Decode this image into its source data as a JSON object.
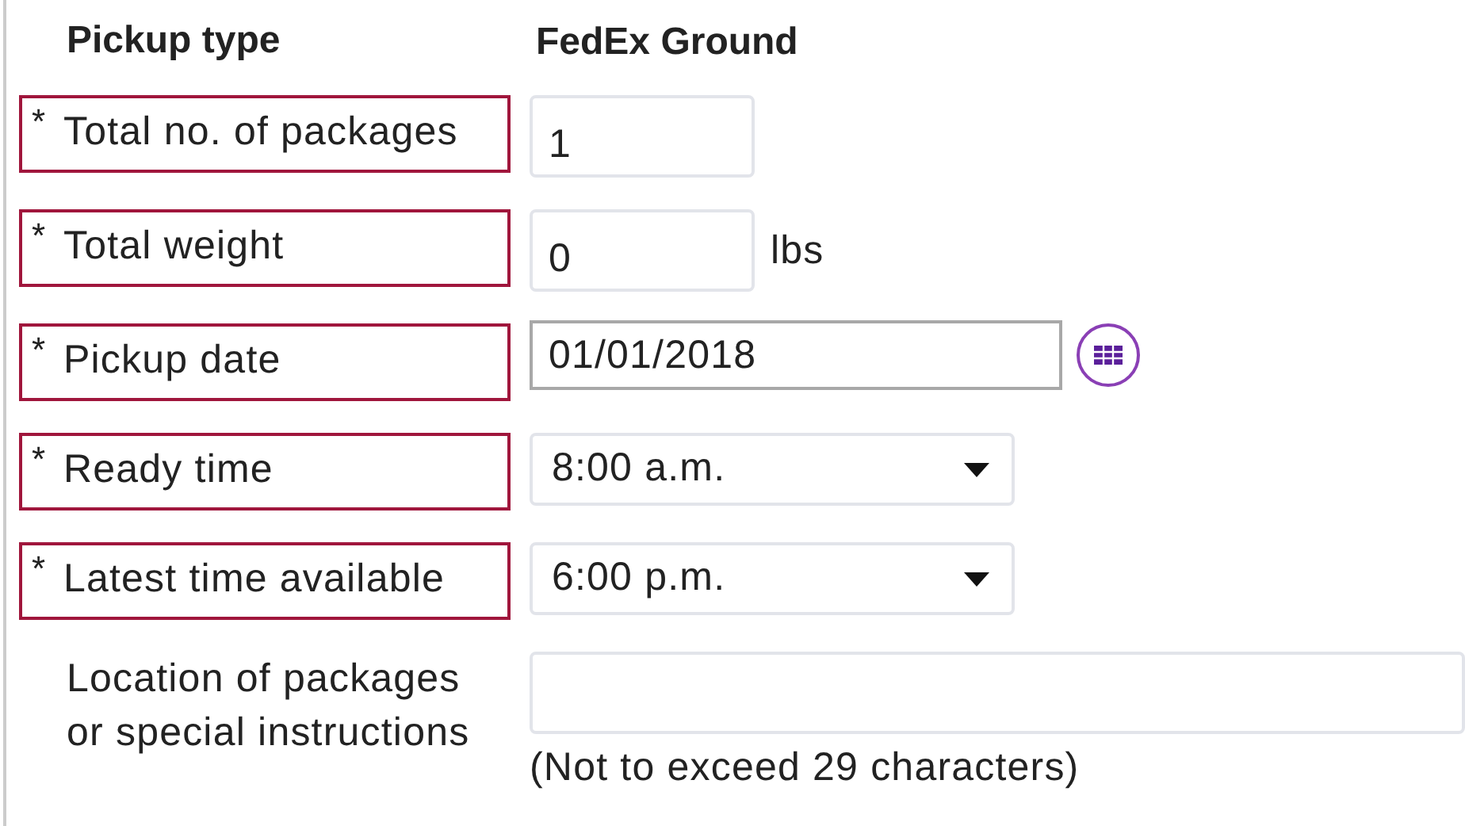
{
  "pickup_type": {
    "label": "Pickup type",
    "value": "FedEx Ground"
  },
  "fields": [
    {
      "label": "Total no. of packages",
      "required_mark": "*",
      "highlighted": true,
      "kind": "text",
      "value": "1"
    },
    {
      "label": "Total weight",
      "required_mark": "*",
      "highlighted": true,
      "kind": "text",
      "value": "0",
      "unit": "lbs"
    },
    {
      "label": "Pickup date",
      "required_mark": "*",
      "highlighted": true,
      "kind": "date",
      "value": "01/01/2018"
    },
    {
      "label": "Ready time",
      "required_mark": "*",
      "highlighted": true,
      "kind": "select",
      "value": "8:00 a.m."
    },
    {
      "label": "Latest time available",
      "required_mark": "*",
      "highlighted": true,
      "kind": "select",
      "value": "6:00 p.m."
    },
    {
      "label": "Location of packages or special instructions",
      "kind": "wide",
      "note": "(Not to exceed 29 characters)"
    }
  ]
}
